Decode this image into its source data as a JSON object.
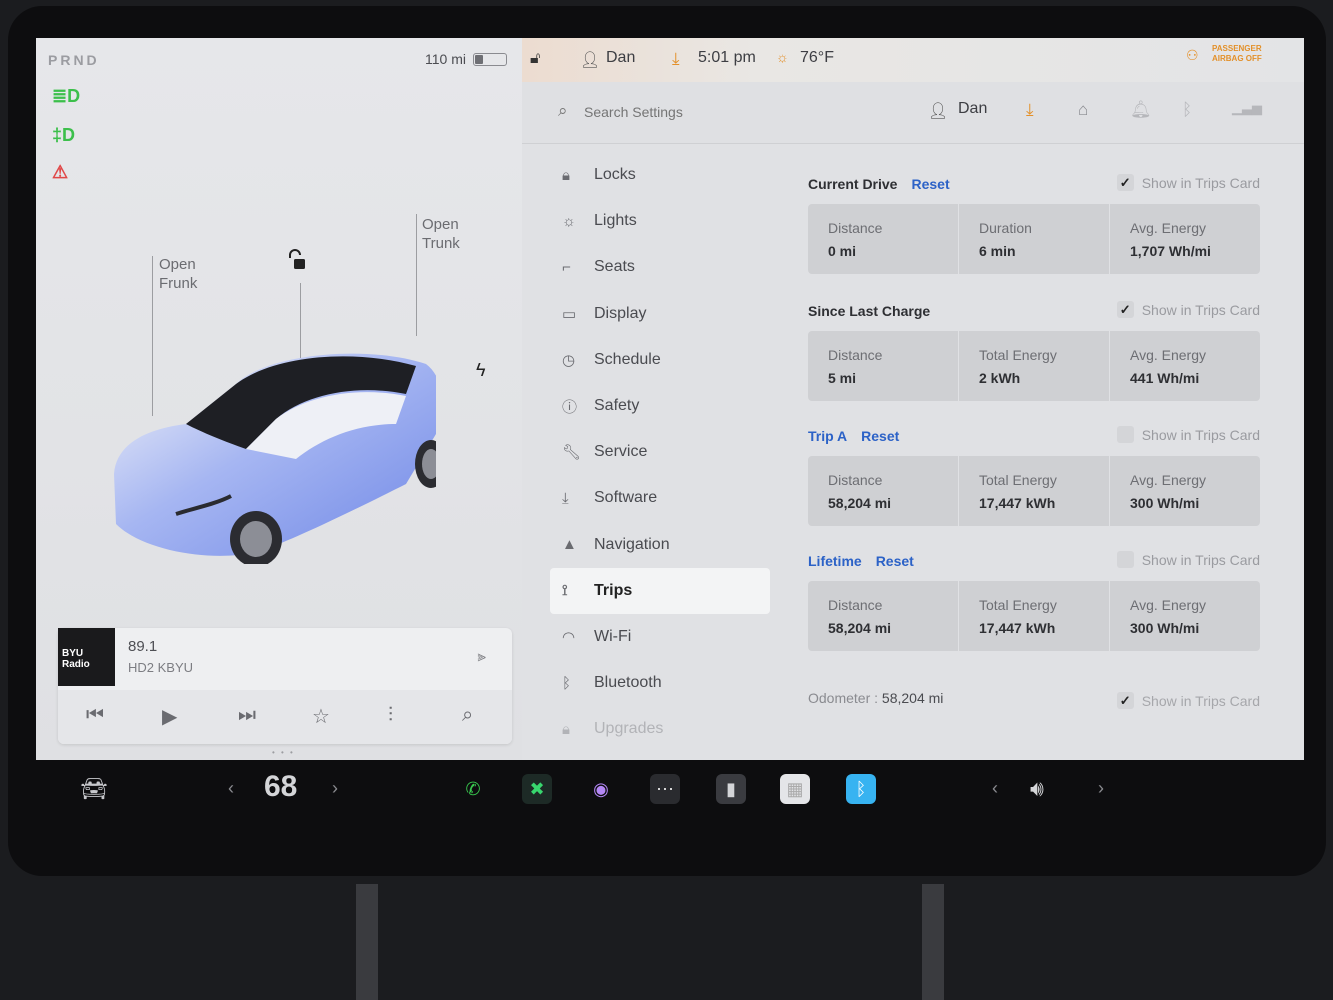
{
  "status": {
    "gear": "PRND",
    "range": "110 mi",
    "battery_level": 0.25
  },
  "car": {
    "frunk_label": "Open\nFrunk",
    "trunk_label": "Open\nTrunk",
    "frunk_l1": "Open",
    "frunk_l2": "Frunk",
    "trunk_l1": "Open",
    "trunk_l2": "Trunk"
  },
  "media": {
    "album_label": "BYU Radio",
    "station": "89.1",
    "subtitle": "HD2 KBYU"
  },
  "map_strip": {
    "user": "Dan",
    "time": "5:01 pm",
    "temperature": "76°F",
    "airbag_line1": "PASSENGER",
    "airbag_line2": "AIRBAG OFF"
  },
  "search": {
    "placeholder": "Search Settings"
  },
  "topbar": {
    "user": "Dan"
  },
  "menu": [
    {
      "label": "Locks",
      "icon": "lock-icon"
    },
    {
      "label": "Lights",
      "icon": "lights-icon"
    },
    {
      "label": "Seats",
      "icon": "seat-icon"
    },
    {
      "label": "Display",
      "icon": "display-icon"
    },
    {
      "label": "Schedule",
      "icon": "schedule-icon"
    },
    {
      "label": "Safety",
      "icon": "safety-icon"
    },
    {
      "label": "Service",
      "icon": "wrench-icon"
    },
    {
      "label": "Software",
      "icon": "download-icon"
    },
    {
      "label": "Navigation",
      "icon": "navigation-icon"
    },
    {
      "label": "Trips",
      "icon": "trips-icon"
    },
    {
      "label": "Wi-Fi",
      "icon": "wifi-icon"
    },
    {
      "label": "Bluetooth",
      "icon": "bluetooth-icon"
    },
    {
      "label": "Upgrades",
      "icon": "upgrades-icon"
    }
  ],
  "show_card_label": "Show in Trips Card",
  "reset_label": "Reset",
  "sections": {
    "current": {
      "title": "Current Drive",
      "checked": true,
      "stats": [
        {
          "k": "Distance",
          "v": "0 mi"
        },
        {
          "k": "Duration",
          "v": "6 min"
        },
        {
          "k": "Avg. Energy",
          "v": "1,707 Wh/mi"
        }
      ]
    },
    "since": {
      "title": "Since Last Charge",
      "checked": true,
      "stats": [
        {
          "k": "Distance",
          "v": "5 mi"
        },
        {
          "k": "Total Energy",
          "v": "2 kWh"
        },
        {
          "k": "Avg. Energy",
          "v": "441 Wh/mi"
        }
      ]
    },
    "tripa": {
      "title": "Trip A",
      "checked": false,
      "stats": [
        {
          "k": "Distance",
          "v": "58,204 mi"
        },
        {
          "k": "Total Energy",
          "v": "17,447 kWh"
        },
        {
          "k": "Avg. Energy",
          "v": "300 Wh/mi"
        }
      ]
    },
    "lifetime": {
      "title": "Lifetime",
      "checked": false,
      "stats": [
        {
          "k": "Distance",
          "v": "58,204 mi"
        },
        {
          "k": "Total Energy",
          "v": "17,447 kWh"
        },
        {
          "k": "Avg. Energy",
          "v": "300 Wh/mi"
        }
      ]
    }
  },
  "odometer": {
    "label": "Odometer :",
    "value": "58,204 mi"
  },
  "dock": {
    "temperature": "68"
  },
  "colors": {
    "accent_blue": "#2c62c7",
    "download_orange": "#e3902a",
    "indicator_green": "#3cbf4b",
    "seatbelt_red": "#e04848",
    "car_blue": "#7f95ec"
  }
}
